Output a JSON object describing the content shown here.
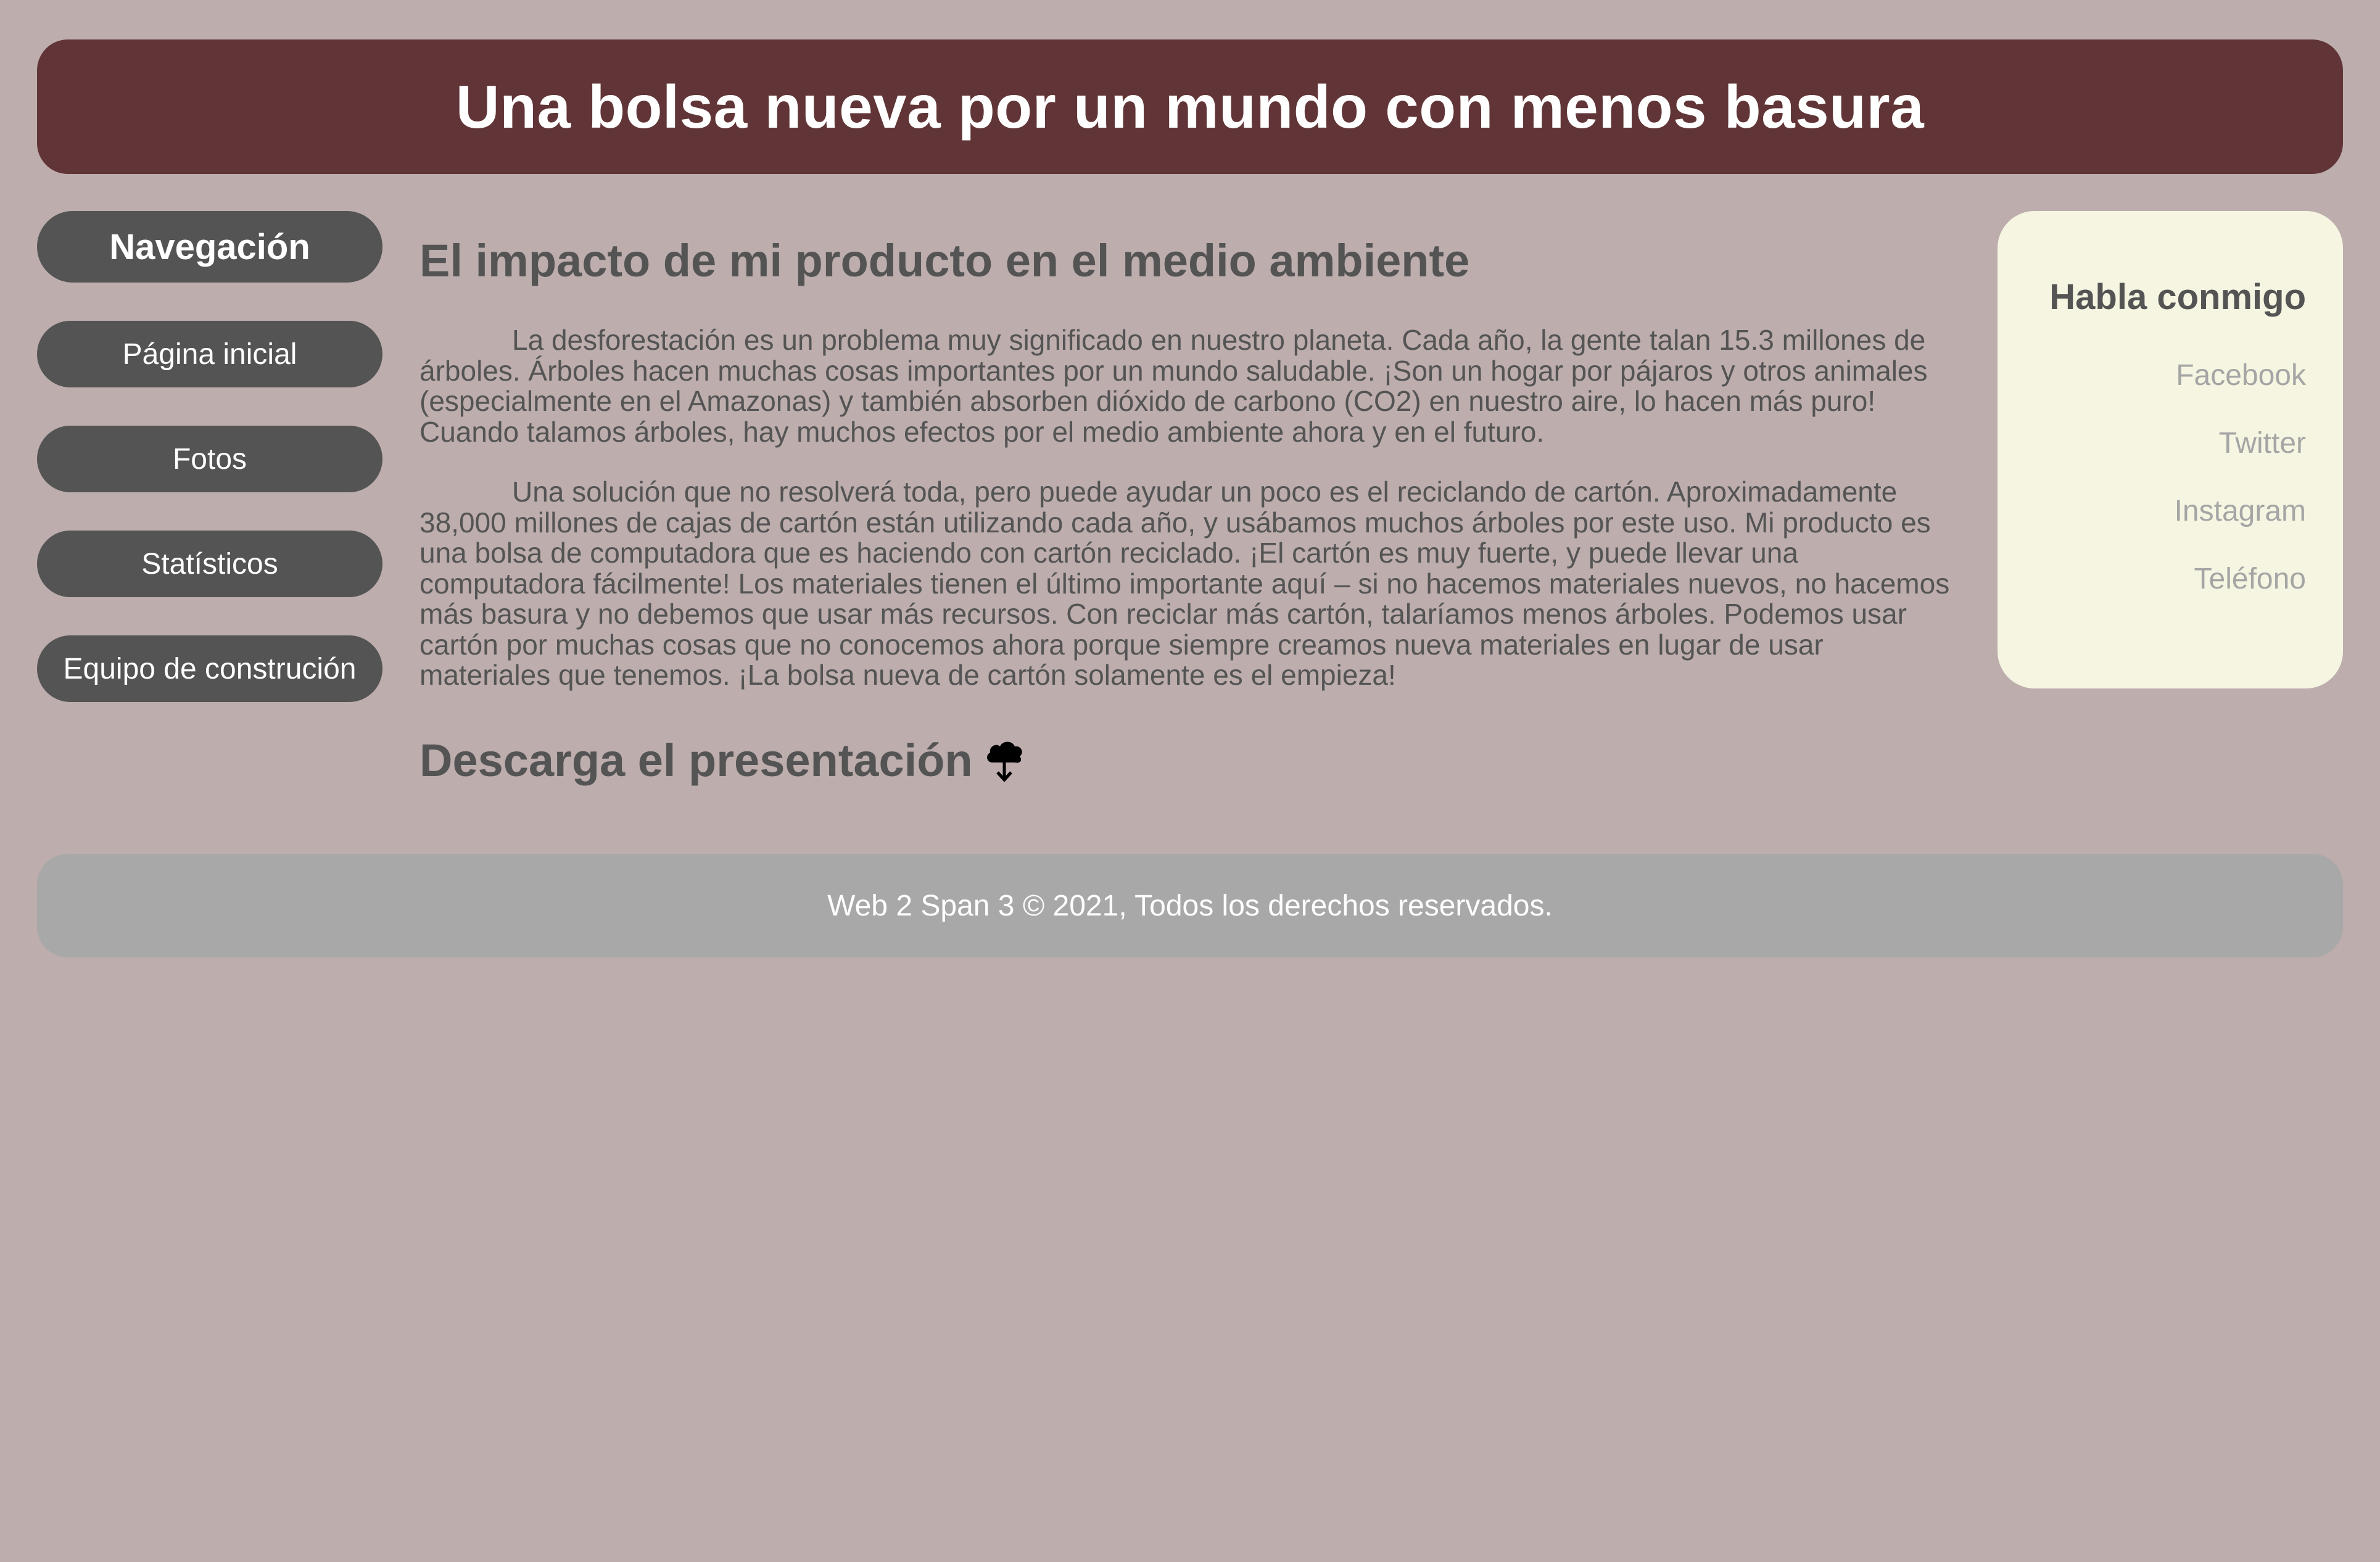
{
  "header": {
    "title": "Una bolsa nueva por un mundo con menos basura"
  },
  "nav": {
    "title": "Navegación",
    "items": [
      {
        "label": "Página inicial"
      },
      {
        "label": "Fotos"
      },
      {
        "label": "Statísticos"
      },
      {
        "label": "Equipo de construción"
      }
    ]
  },
  "main": {
    "heading": "El impacto de mi producto en el medio ambiente",
    "paragraph1": "La desforestación es un problema muy significado en nuestro planeta. Cada año, la gente talan 15.3 millones de árboles. Árboles hacen muchas cosas importantes por un mundo saludable. ¡Son un hogar por pájaros y otros animales (especialmente en el Amazonas) y también absorben dióxido de carbono (CO2) en nuestro aire, lo hacen más puro! Cuando talamos árboles, hay muchos efectos por el medio ambiente ahora y en el futuro.",
    "paragraph2": "Una solución que no resolverá toda, pero puede ayudar un poco es el reciclando de cartón. Aproximadamente 38,000 millones de cajas de cartón están utilizando cada año, y usábamos muchos árboles por este uso. Mi producto es una bolsa de computadora que es haciendo con cartón reciclado. ¡El cartón es muy fuerte, y puede llevar una computadora fácilmente! Los materiales tienen el último importante aquí – si no hacemos materiales nuevos, no hacemos más basura y no debemos que usar más recursos. Con reciclar más cartón, talaríamos menos árboles. Podemos usar cartón por muchas cosas que no conocemos ahora porque siempre creamos nueva materiales en lugar de usar materiales que tenemos. ¡La bolsa nueva de cartón solamente es el empieza!",
    "download_label": "Descarga el presentación",
    "download_icon": "cloud-download-icon"
  },
  "aside": {
    "title": "Habla conmigo",
    "contacts": [
      {
        "label": "Facebook"
      },
      {
        "label": "Twitter"
      },
      {
        "label": "Instagram"
      },
      {
        "label": "Teléfono"
      }
    ]
  },
  "footer": {
    "text": "Web 2 Span 3 © 2021, Todos los derechos reservados."
  },
  "colors": {
    "background": "#bdadad",
    "header": "#613537",
    "nav_button": "#545454",
    "aside_background": "#f5f5e1",
    "footer": "#a8a8a8",
    "body_text": "#545454",
    "muted_link": "#a5a5a5"
  }
}
